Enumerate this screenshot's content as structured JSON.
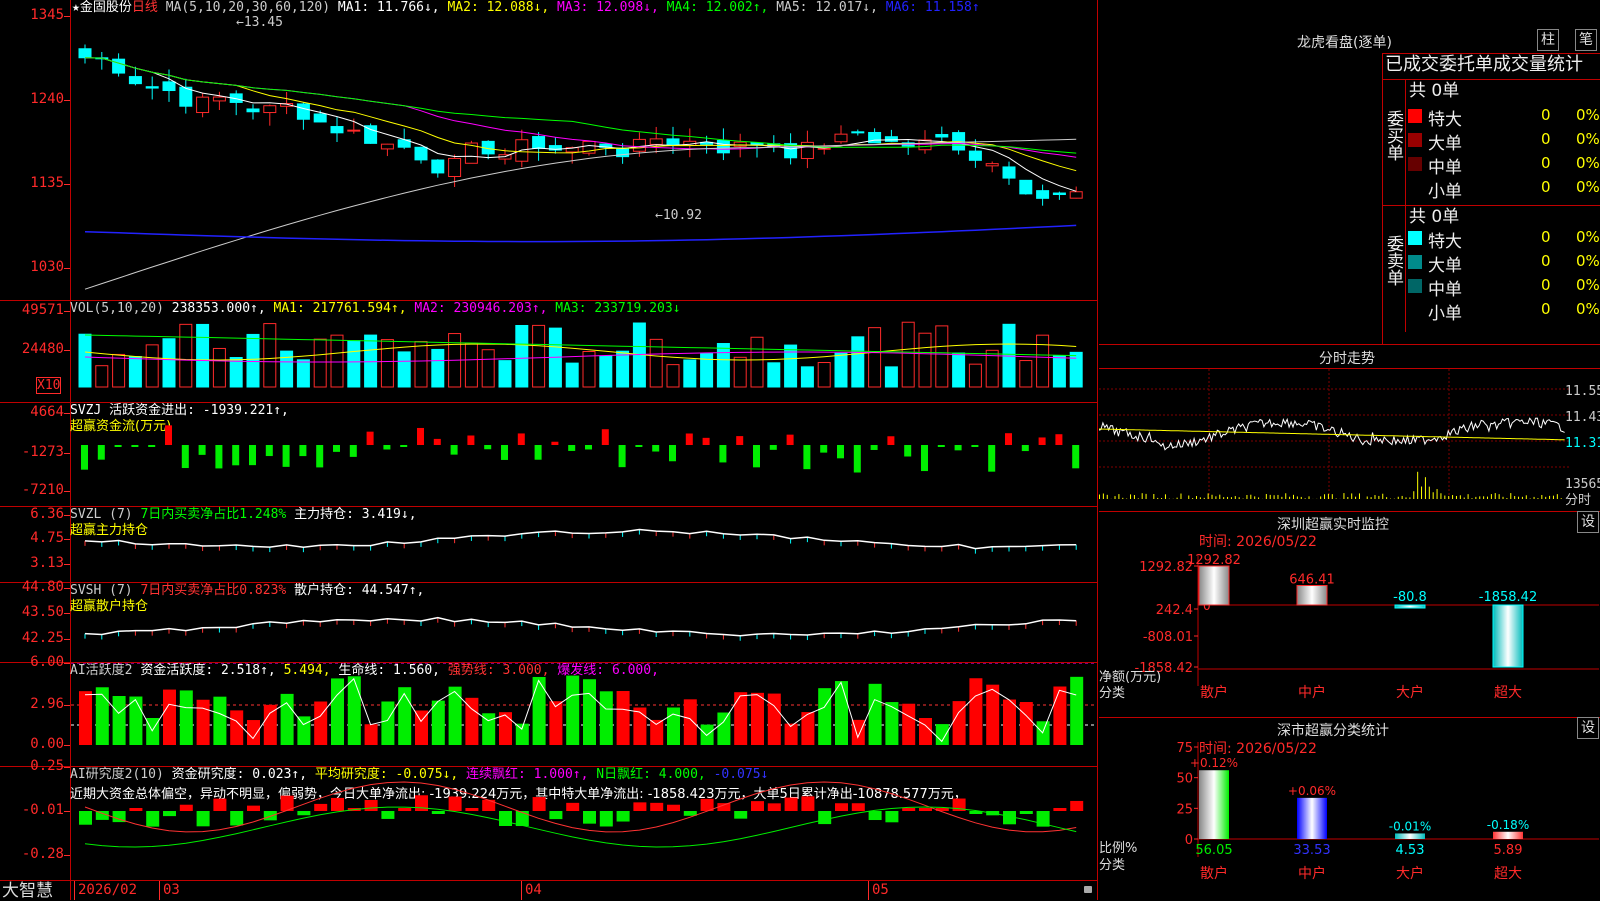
{
  "main": {
    "header": {
      "star": "★",
      "stock_name": "金固股份",
      "period": "日线",
      "ma_param": "MA(5,10,20,30,60,120)",
      "items": [
        {
          "text": "MA1: 11.766↓,",
          "color": "#ffffff"
        },
        {
          "text": "MA2: 12.088↓,",
          "color": "#ffff00"
        },
        {
          "text": "MA3: 12.098↓,",
          "color": "#ff00ff"
        },
        {
          "text": "MA4: 12.002↑,",
          "color": "#00ff00"
        },
        {
          "text": "MA5: 12.017↓,",
          "color": "#cccccc"
        },
        {
          "text": "MA6: 11.158↑",
          "color": "#2222ff"
        }
      ]
    },
    "y_labels": [
      "1345",
      "1240",
      "1135",
      "1030"
    ],
    "high_label": "13.45",
    "low_label": "10.92"
  },
  "volume": {
    "header": [
      {
        "text": "VOL(5,10,20)",
        "color": "#cccccc"
      },
      {
        "text": "238353.000↑,",
        "color": "#ffffff"
      },
      {
        "text": "MA1: 217761.594↑,",
        "color": "#ffff00"
      },
      {
        "text": "MA2: 230946.203↑,",
        "color": "#ff00ff"
      },
      {
        "text": "MA3: 233719.203↓",
        "color": "#00ff00"
      }
    ],
    "y_labels": [
      "49571",
      "24480"
    ],
    "unit": "X10"
  },
  "svzj": {
    "header": [
      {
        "text": "SVZJ  活跃资金进出: -1939.221↑,",
        "color": "#ffffff"
      }
    ],
    "subtitle": "超赢资金流(万元)",
    "y_labels": [
      "4664",
      "-1273",
      "-7210"
    ]
  },
  "svzl": {
    "header": [
      {
        "text": "SVZL (7)",
        "color": "#cccccc"
      },
      {
        "text": "7日内买卖净占比1.248%",
        "color": "#00ff00"
      },
      {
        "text": "主力持仓: 3.419↓,",
        "color": "#ffffff"
      }
    ],
    "subtitle": "超赢主力持仓",
    "y_labels": [
      "6.36",
      "4.75",
      "3.13"
    ]
  },
  "svsh": {
    "header": [
      {
        "text": "SVSH (7)",
        "color": "#cccccc"
      },
      {
        "text": "7日内买卖净占比0.823%",
        "color": "#ff3333"
      },
      {
        "text": "散户持仓: 44.547↑,",
        "color": "#ffffff"
      }
    ],
    "subtitle": "超赢散户持仓",
    "y_labels": [
      "44.80",
      "43.50",
      "42.25"
    ]
  },
  "ai_active": {
    "header": [
      {
        "text": "AI活跃度2",
        "color": "#cccccc"
      },
      {
        "text": "资金活跃度: 2.518↑,",
        "color": "#ffffff"
      },
      {
        "text": "5.494,",
        "color": "#ffff00"
      },
      {
        "text": "生命线: 1.560,",
        "color": "#ffffff"
      },
      {
        "text": "强势线: 3.000,",
        "color": "#ff3333"
      },
      {
        "text": "爆发线: 6.000,",
        "color": "#ff00ff"
      }
    ],
    "y_labels": [
      "6.00",
      "2.96",
      "0.00"
    ]
  },
  "ai_research": {
    "header": [
      {
        "text": "AI研究度2(10)",
        "color": "#cccccc"
      },
      {
        "text": "资金研究度: 0.023↑,",
        "color": "#ffffff"
      },
      {
        "text": "平均研究度: -0.075↓,",
        "color": "#ffff00"
      },
      {
        "text": "连续飘红: 1.000↑,",
        "color": "#ff00ff"
      },
      {
        "text": "N日飘红: 4.000,",
        "color": "#00ff00"
      },
      {
        "text": "-0.075↓",
        "color": "#3333ff"
      }
    ],
    "comment": "近期大资金总体偏空，异动不明显，偏弱势，今日大单净流出: -1939.224万元，其中特大单净流出: -1858.423万元，大单5日累计净出-10878.577万元，",
    "y_labels": [
      "0.25",
      "-0.01",
      "-0.28"
    ]
  },
  "bottom_bar": {
    "brand": "大智慧",
    "date_labels": [
      "2026/02",
      "03",
      "04",
      "05"
    ]
  },
  "right": {
    "lhb_title": "龙虎看盘(逐单)",
    "btn_bar": "柱",
    "btn_pen": "笔",
    "order_title": "已成交委托单成交量统计",
    "buy_label": "委买单",
    "sell_label": "委卖单",
    "buy_total": "共 0单",
    "sell_total": "共 0单",
    "buy_rows": [
      {
        "name": "特大",
        "count": "0",
        "pct": "0%",
        "color": "#ff0000"
      },
      {
        "name": "大单",
        "count": "0",
        "pct": "0%",
        "color": "#990000"
      },
      {
        "name": "中单",
        "count": "0",
        "pct": "0%",
        "color": "#660000"
      },
      {
        "name": "小单",
        "count": "0",
        "pct": "0%",
        "color": ""
      }
    ],
    "sell_rows": [
      {
        "name": "特大",
        "count": "0",
        "pct": "0%",
        "color": "#00ffff"
      },
      {
        "name": "大单",
        "count": "0",
        "pct": "0%",
        "color": "#008b8b"
      },
      {
        "name": "中单",
        "count": "0",
        "pct": "0%",
        "color": "#006666"
      },
      {
        "name": "小单",
        "count": "0",
        "pct": "0%",
        "color": ""
      }
    ],
    "intraday_title": "分时走势",
    "intraday_prices": [
      "11.55",
      "11.43",
      "11.31"
    ],
    "intraday_vol": "13565",
    "intraday_vol_label": "分时",
    "sz_monitor": {
      "title": "深圳超赢实时监控",
      "settings": "设",
      "time": "时间: 2026/05/22",
      "y_labels": [
        "1292.82",
        "242.4",
        "-808.01",
        "-1858.42"
      ],
      "zero": "0",
      "axis_title1": "净额(万元)",
      "axis_title2": "分类",
      "categories": [
        "散户",
        "中户",
        "大户",
        "超大"
      ],
      "value_labels": [
        "1292.82",
        "646.41",
        "-80.8",
        "-1858.42"
      ]
    },
    "sz_classify": {
      "title": "深市超赢分类统计",
      "settings": "设",
      "time": "时间: 2026/05/22",
      "y_labels": [
        "75",
        "50",
        "25",
        "0"
      ],
      "axis_title1": "比例%",
      "axis_title2": "分类",
      "categories": [
        "散户",
        "中户",
        "大户",
        "超大"
      ],
      "top_labels": [
        "+0.12%",
        "+0.06%",
        "-0.01%",
        "-0.18%"
      ],
      "bottom_labels": [
        "56.05",
        "33.53",
        "4.53",
        "5.89"
      ]
    }
  }
}
